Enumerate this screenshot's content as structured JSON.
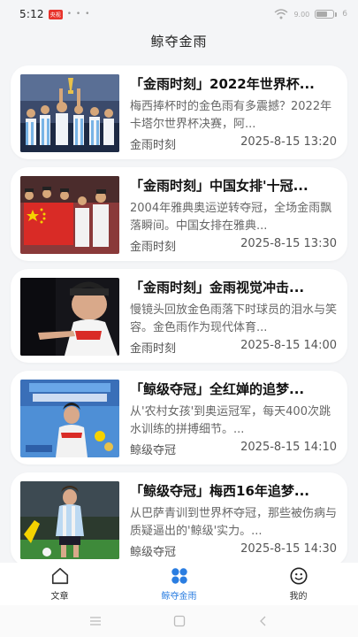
{
  "status_bar": {
    "time": "5:12",
    "app_badge": "央视",
    "dots": "• • •",
    "network": "9.00",
    "battery": "6"
  },
  "header": {
    "title": "鲸夺金雨"
  },
  "articles": [
    {
      "title": "「金雨时刻」2022年世界杯...",
      "summary": "梅西捧杯时的金色雨有多震撼？2022年卡塔尔世界杯决赛，阿...",
      "category": "金雨时刻",
      "date": "2025-8-15 13:20",
      "thumb_icon": "trophy-celebration-photo"
    },
    {
      "title": "「金雨时刻」中国女排'十冠...",
      "summary": "2004年雅典奥运逆转夺冠，全场金雨飘落瞬间。中国女排在雅典...",
      "category": "金雨时刻",
      "date": "2025-8-15 13:30",
      "thumb_icon": "volleyball-team-flag-photo"
    },
    {
      "title": "「金雨时刻」金雨视觉冲击...",
      "summary": "慢镜头回放金色雨落下时球员的泪水与笑容。金色雨作为现代体育...",
      "category": "金雨时刻",
      "date": "2025-8-15 14:00",
      "thumb_icon": "athlete-closeup-photo"
    },
    {
      "title": "「鲸级夺冠」全红婵的追梦...",
      "summary": "从'农村女孩'到奥运冠军，每天400次跳水训练的拼搏细节。...",
      "category": "鲸级夺冠",
      "date": "2025-8-15 14:10",
      "thumb_icon": "diver-poster-photo"
    },
    {
      "title": "「鲸级夺冠」梅西16年追梦...",
      "summary": "从巴萨青训到世界杯夺冠，那些被伤病与质疑逼出的'鲸级'实力。...",
      "category": "鲸级夺冠",
      "date": "2025-8-15 14:30",
      "thumb_icon": "footballer-photo"
    }
  ],
  "tabs": [
    {
      "label": "文章",
      "icon": "home-icon",
      "active": false
    },
    {
      "label": "鲸夺金雨",
      "icon": "clover-grid-icon",
      "active": true
    },
    {
      "label": "我的",
      "icon": "smiley-face-icon",
      "active": false
    }
  ],
  "colors": {
    "accent": "#2a7de1",
    "background": "#f4f5f7",
    "card": "#ffffff",
    "status_badge": "#e8332b"
  }
}
